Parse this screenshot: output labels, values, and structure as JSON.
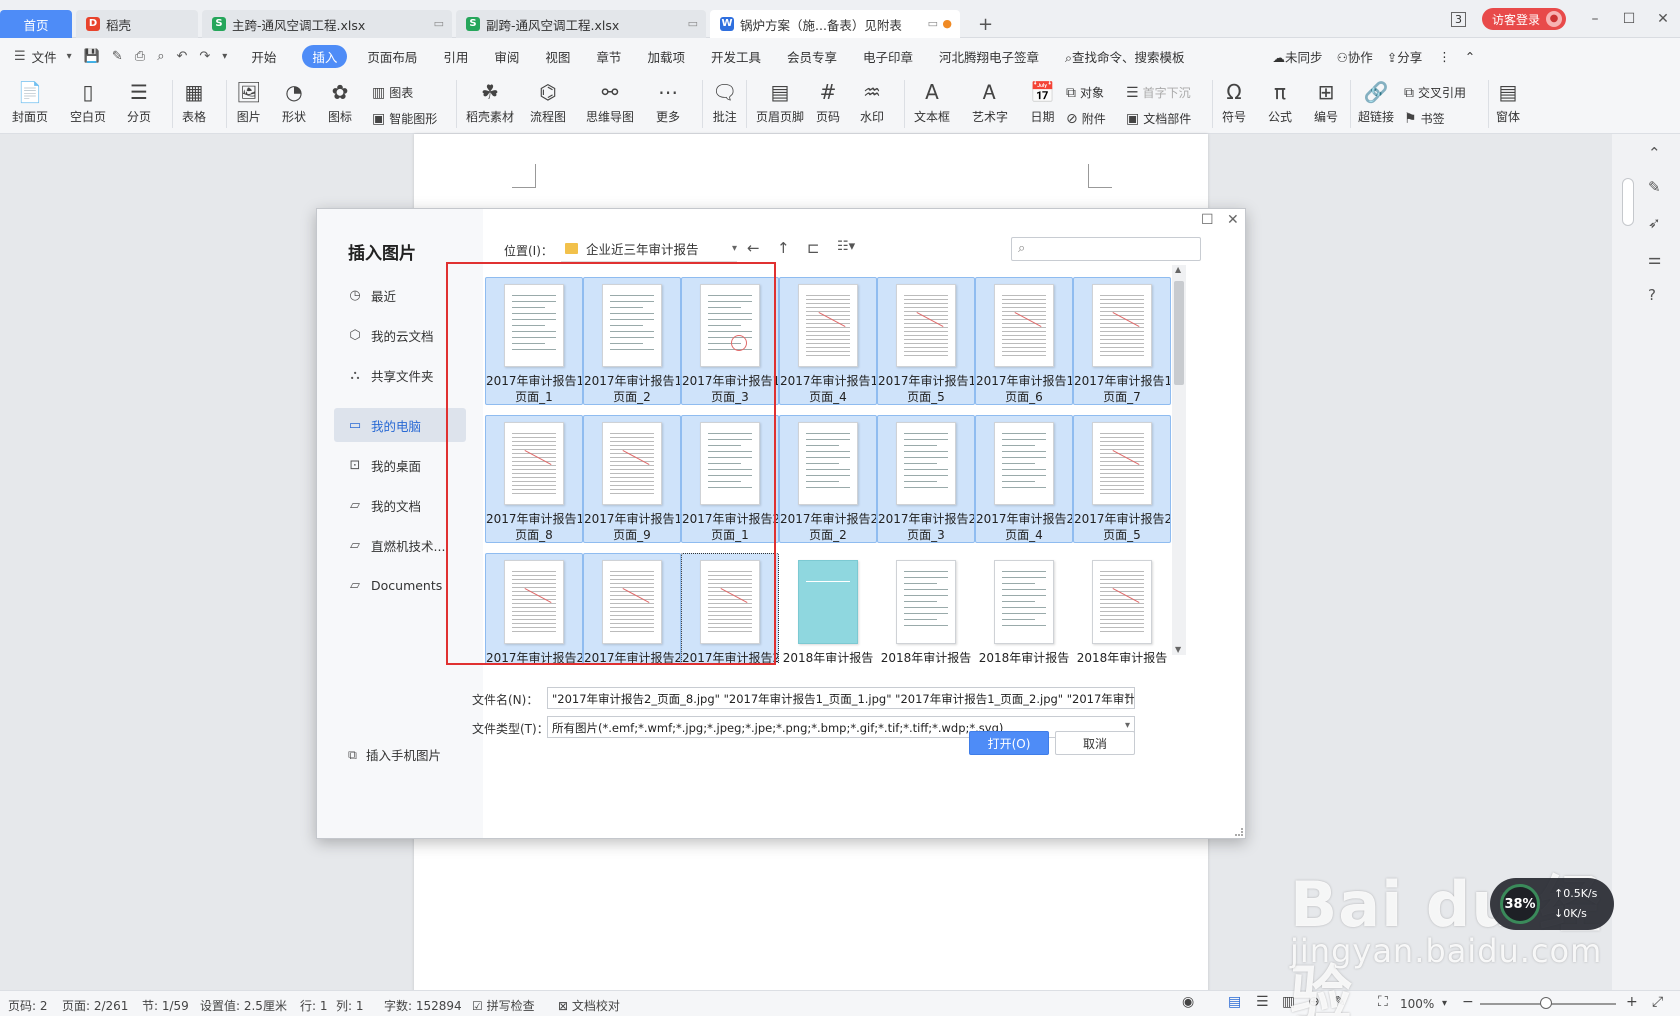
{
  "tabs": [
    {
      "label": "首页",
      "kind": "home"
    },
    {
      "label": "稻壳",
      "kind": "docer"
    },
    {
      "label": "主跨-通风空调工程.xlsx",
      "kind": "sheet"
    },
    {
      "label": "副跨-通风空调工程.xlsx",
      "kind": "sheet"
    },
    {
      "label": "锅炉方案（施...备表）见附表",
      "kind": "writer"
    }
  ],
  "top_right": {
    "badge": "3",
    "login": "访客登录"
  },
  "menubar": {
    "file": "文件",
    "items": [
      "开始",
      "插入",
      "页面布局",
      "引用",
      "审阅",
      "视图",
      "章节",
      "加载项",
      "开发工具",
      "会员专享",
      "电子印章",
      "河北腾翔电子签章"
    ],
    "active": "插入",
    "search": "查找命令、搜索模板",
    "right": [
      "未同步",
      "协作",
      "分享"
    ]
  },
  "ribbon": {
    "items": [
      "封面页",
      "空白页",
      "分页",
      "表格",
      "图片",
      "形状",
      "图标",
      "稻壳素材",
      "流程图",
      "思维导图",
      "更多",
      "批注",
      "页眉页脚",
      "页码",
      "水印",
      "文本框",
      "艺术字",
      "日期",
      "符号",
      "公式",
      "编号",
      "超链接",
      "窗体"
    ],
    "small": [
      "图表",
      "智能图形",
      "对象",
      "首字下沉",
      "附件",
      "文档部件",
      "交叉引用",
      "书签"
    ]
  },
  "dialog": {
    "title": "插入图片",
    "sidebar": [
      "最近",
      "我的云文档",
      "共享文件夹",
      "我的电脑",
      "我的桌面",
      "我的文档",
      "直燃机技术...",
      "Documents"
    ],
    "active_sidebar": "我的电脑",
    "phone": "插入手机图片",
    "location_label": "位置(I)：",
    "location": "企业近三年审计报告",
    "files": [
      {
        "l1": "2017年审计报告1_",
        "l2": "页面_1"
      },
      {
        "l1": "2017年审计报告1_",
        "l2": "页面_2"
      },
      {
        "l1": "2017年审计报告1_",
        "l2": "页面_3"
      },
      {
        "l1": "2017年审计报告1_",
        "l2": "页面_4"
      },
      {
        "l1": "2017年审计报告1_",
        "l2": "页面_5"
      },
      {
        "l1": "2017年审计报告1_",
        "l2": "页面_6"
      },
      {
        "l1": "2017年审计报告1_",
        "l2": "页面_7"
      },
      {
        "l1": "2017年审计报告1_",
        "l2": "页面_8"
      },
      {
        "l1": "2017年审计报告1_",
        "l2": "页面_9"
      },
      {
        "l1": "2017年审计报告2_",
        "l2": "页面_1"
      },
      {
        "l1": "2017年审计报告2_",
        "l2": "页面_2"
      },
      {
        "l1": "2017年审计报告2_",
        "l2": "页面_3"
      },
      {
        "l1": "2017年审计报告2_",
        "l2": "页面_4"
      },
      {
        "l1": "2017年审计报告2_",
        "l2": "页面_5"
      },
      {
        "l1": "2017年审计报告2_",
        "l2": ""
      },
      {
        "l1": "2017年审计报告2_",
        "l2": ""
      },
      {
        "l1": "2017年审计报告2_",
        "l2": ""
      },
      {
        "l1": "2018年审计报告",
        "l2": ""
      },
      {
        "l1": "2018年审计报告",
        "l2": ""
      },
      {
        "l1": "2018年审计报告",
        "l2": ""
      },
      {
        "l1": "2018年审计报告",
        "l2": ""
      }
    ],
    "filename_label": "文件名(N)：",
    "filename": "\"2017年审计报告2_页面_8.jpg\" \"2017年审计报告1_页面_1.jpg\" \"2017年审计报告1_页面_2.jpg\" \"2017年审计报告",
    "filetype_label": "文件类型(T)：",
    "filetype": "所有图片(*.emf;*.wmf;*.jpg;*.jpeg;*.jpe;*.png;*.bmp;*.gif;*.tif;*.tiff;*.wdp;*.svg)",
    "open": "打开(O)",
    "cancel": "取消"
  },
  "status": {
    "items": [
      "页码: 2",
      "页面: 2/261",
      "节: 1/59",
      "设置值: 2.5厘米",
      "行: 1",
      "列: 1",
      "字数: 152894",
      "拼写检查",
      "文档校对"
    ],
    "zoom": "100%"
  },
  "watermark": {
    "line1": "Bai du 经验",
    "line2": "jingyan.baidu.com"
  },
  "net": {
    "up": "0.5K/s",
    "down": "0K/s",
    "pct": "38%"
  },
  "colors": {
    "accent": "#4e8cf7",
    "selection": "#cfe3fa",
    "highlight": "#e03131",
    "login": "#e84a4a"
  }
}
